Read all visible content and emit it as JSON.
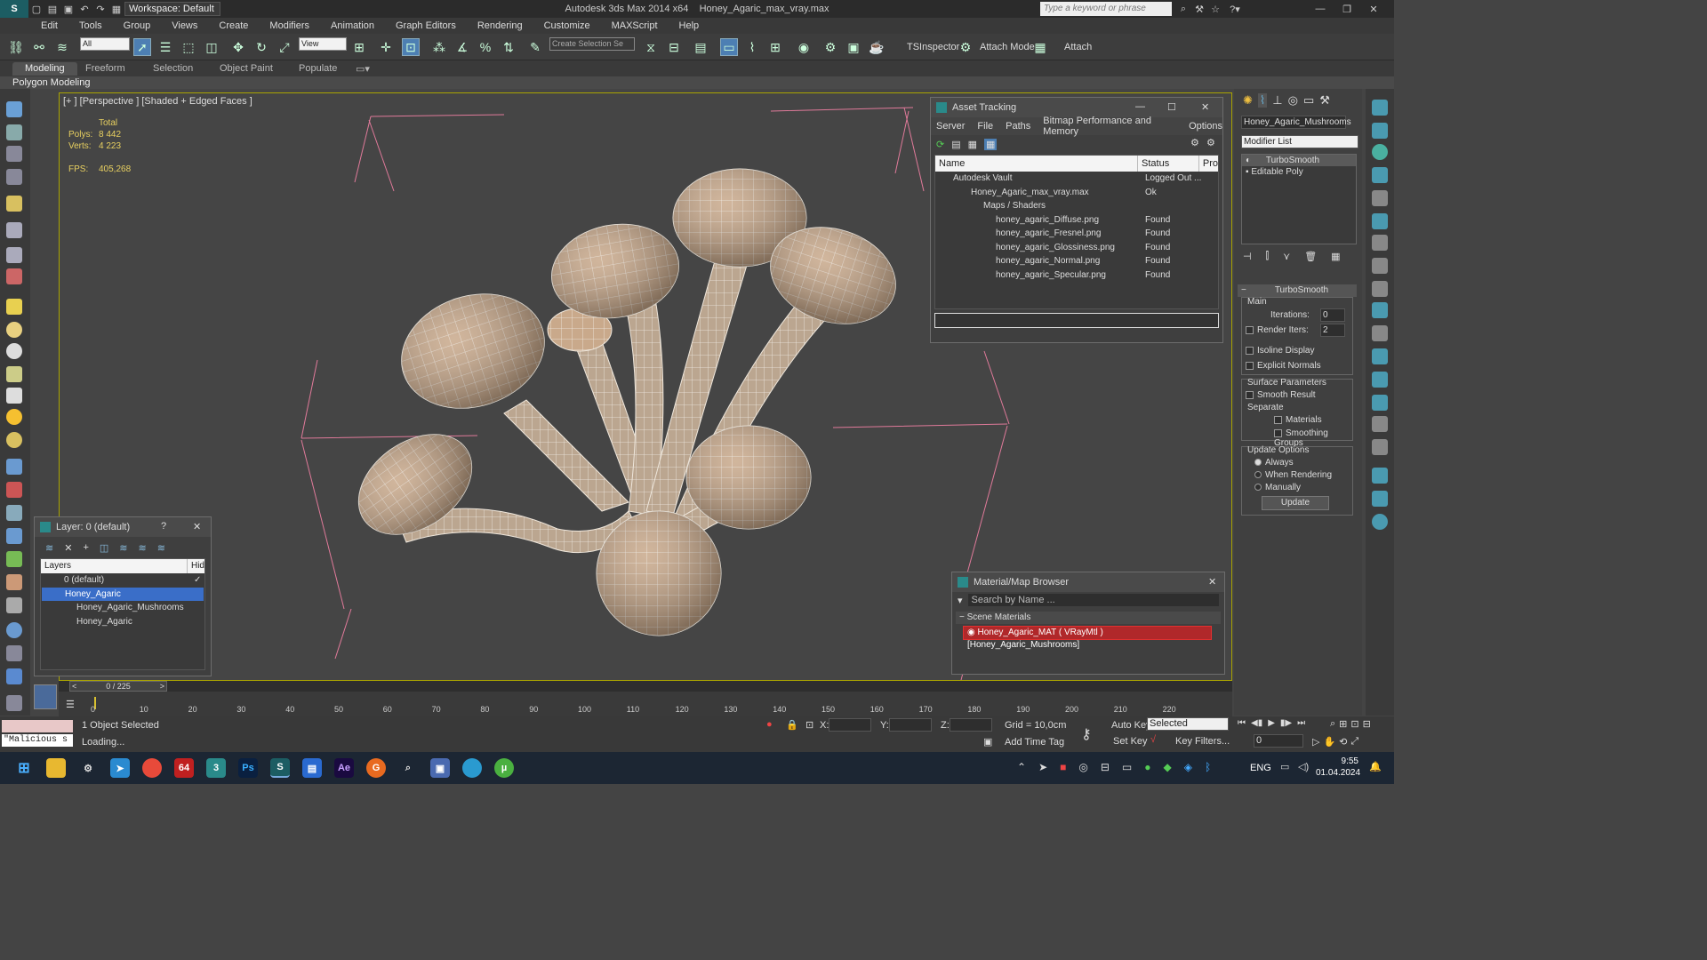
{
  "app": {
    "title": "Autodesk 3ds Max  2014 x64",
    "file": "Honey_Agaric_max_vray.max",
    "workspace": "Workspace: Default",
    "search_placeholder": "Type a keyword or phrase"
  },
  "menu": [
    "Edit",
    "Tools",
    "Group",
    "Views",
    "Create",
    "Modifiers",
    "Animation",
    "Graph Editors",
    "Rendering",
    "Customize",
    "MAXScript",
    "Help"
  ],
  "toolbar": {
    "filter": "All",
    "ref_coord": "View",
    "selection_set": "Create Selection Se",
    "ts_inspector": "TSInspector",
    "attach_mode": "Attach Mode",
    "attach": "Attach"
  },
  "ribbon": {
    "tabs": [
      "Modeling",
      "Freeform",
      "Selection",
      "Object Paint",
      "Populate"
    ],
    "sub": "Polygon Modeling"
  },
  "viewport": {
    "label": "[+ ] [Perspective ] [Shaded + Edged Faces ]",
    "stats": {
      "total": "Total",
      "polys_label": "Polys:",
      "polys": "8 442",
      "verts_label": "Verts:",
      "verts": "4 223",
      "fps_label": "FPS:",
      "fps": "405,268"
    }
  },
  "asset_tracking": {
    "title": "Asset Tracking",
    "menu": [
      "Server",
      "File",
      "Paths",
      "Bitmap Performance and Memory",
      "Options"
    ],
    "columns": [
      "Name",
      "Status",
      "Pro"
    ],
    "rows": [
      {
        "name": "Autodesk Vault",
        "status": "Logged Out ..."
      },
      {
        "name": "Honey_Agaric_max_vray.max",
        "status": "Ok"
      },
      {
        "name": "Maps / Shaders",
        "status": ""
      },
      {
        "name": "honey_agaric_Diffuse.png",
        "status": "Found"
      },
      {
        "name": "honey_agaric_Fresnel.png",
        "status": "Found"
      },
      {
        "name": "honey_agaric_Glossiness.png",
        "status": "Found"
      },
      {
        "name": "honey_agaric_Normal.png",
        "status": "Found"
      },
      {
        "name": "honey_agaric_Specular.png",
        "status": "Found"
      }
    ]
  },
  "layer": {
    "title": "Layer: 0 (default)",
    "help": "?",
    "col_layers": "Layers",
    "col_hide": "Hid",
    "rows": [
      {
        "name": "0 (default)"
      },
      {
        "name": "Honey_Agaric"
      },
      {
        "name": "Honey_Agaric_Mushrooms"
      },
      {
        "name": "Honey_Agaric"
      }
    ]
  },
  "material_browser": {
    "title": "Material/Map Browser",
    "search": "Search by Name ...",
    "group": "Scene Materials",
    "item": "Honey_Agaric_MAT ( VRayMtl ) [Honey_Agaric_Mushrooms]"
  },
  "command_panel": {
    "object_name": "Honey_Agaric_Mushrooms",
    "modifier_list": "Modifier List",
    "stack": [
      "TurboSmooth",
      "Editable Poly"
    ],
    "rollout": "TurboSmooth",
    "main": "Main",
    "iterations_label": "Iterations:",
    "iterations": "0",
    "render_iters_label": "Render Iters:",
    "render_iters": "2",
    "isoline": "Isoline Display",
    "explicit": "Explicit Normals",
    "surface": "Surface Parameters",
    "smooth_result": "Smooth Result",
    "separate": "Separate",
    "materials": "Materials",
    "smoothing": "Smoothing Groups",
    "update_options": "Update Options",
    "always": "Always",
    "when_rendering": "When Rendering",
    "manually": "Manually",
    "update": "Update"
  },
  "timeline": {
    "frame": "0 / 225",
    "ticks": [
      "0",
      "10",
      "20",
      "30",
      "40",
      "50",
      "60",
      "70",
      "80",
      "90",
      "100",
      "110",
      "120",
      "130",
      "140",
      "150",
      "160",
      "170",
      "180",
      "190",
      "200",
      "210",
      "220"
    ]
  },
  "status": {
    "script": "\"Malicious s",
    "selected": "1 Object Selected",
    "loading": "Loading...",
    "x": "X:",
    "y": "Y:",
    "z": "Z:",
    "grid": "Grid = 10,0cm",
    "add_time_tag": "Add Time Tag",
    "auto_key": "Auto Key",
    "set_key": "Set Key",
    "key_mode": "Selected",
    "key_filters": "Key Filters...",
    "frame": "0"
  },
  "taskbar": {
    "lang": "ENG",
    "time": "9:55",
    "date": "01.04.2024",
    "badge": "64"
  },
  "colors": {
    "accent": "#4d7fb3",
    "viewport_border": "#aaa400",
    "mushroom": "#c9a98b"
  }
}
